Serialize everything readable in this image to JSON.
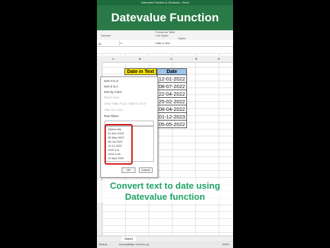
{
  "window": {
    "title": "Datevalue Function & Shortcuts - Excel"
  },
  "banner": {
    "title": "Datevalue Function"
  },
  "ribbon": {
    "number_label": "Number",
    "styles_label": "Styles",
    "cell_styles": "Cell Styles",
    "format_as_table": "Format as Table"
  },
  "formula_bar": {
    "name_box": "A1",
    "fx": "fx",
    "value": "Date in Text"
  },
  "columns": [
    "A",
    "B",
    "C",
    "D",
    "E"
  ],
  "headers": {
    "b": "Date in Text",
    "c": "Date"
  },
  "colors": {
    "header_yellow": "#ffe400",
    "header_blue": "#9dc3e6",
    "banner": "#2a7a47",
    "caption": "#21a366",
    "highlight": "#d01818"
  },
  "dates": [
    "12-01-2022",
    "08-07-2022",
    "22-04-2022",
    "25-02-2022",
    "08-04-2022",
    "01-12-2023",
    "05-05-2022"
  ],
  "filter_menu": {
    "sort_az": "Sort A to Z",
    "sort_za": "Sort Z to A",
    "sort_color": "Sort by Color",
    "sheet_view": "Sheet View",
    "clear_filter": "Clear Filter From \"Date in Text\"",
    "filter_color": "Filter by Color",
    "text_filters": "Text Filters",
    "search": "Search",
    "items": [
      "(Select All)",
      "01-Dec-2023",
      "05-May-2022",
      "08-Jul-2022",
      "12-01-2022",
      "2022-4-8",
      "2022-2-25",
      "22 April 2022"
    ],
    "ok": "OK",
    "cancel": "Cancel"
  },
  "caption": {
    "line1": "Convert text to date using",
    "line2": "Datevalue function"
  },
  "sheet_tab": "Sheet1",
  "status": {
    "ready": "Ready",
    "accessibility": "Accessibility: Good to go",
    "zoom": "100%"
  }
}
